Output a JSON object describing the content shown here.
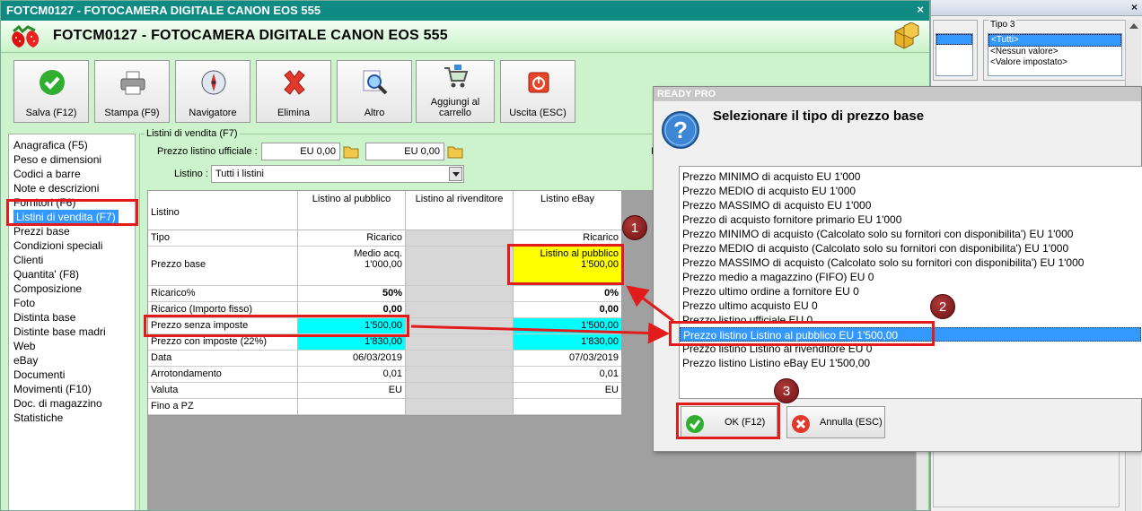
{
  "background_window": {
    "group_label": "Tipo 3",
    "options": [
      "<Tutti>",
      "<Nessun valore>",
      "<Valore impostato>"
    ]
  },
  "window": {
    "title": "FOTCM0127 - FOTOCAMERA DIGITALE CANON EOS 555",
    "close_glyph": "×",
    "header_title": "FOTCM0127 - FOTOCAMERA DIGITALE CANON EOS 555"
  },
  "toolbar": {
    "save": "Salva (F12)",
    "print": "Stampa (F9)",
    "navigator": "Navigatore",
    "delete": "Elimina",
    "other": "Altro",
    "cart_line1": "Aggiungi al",
    "cart_line2": "carrello",
    "exit": "Uscita (ESC)"
  },
  "nav": {
    "items": [
      "Anagrafica (F5)",
      "Peso e dimensioni",
      "Codici a barre",
      "Note e descrizioni",
      "Fornitori (F6)",
      "Listini di vendita (F7)",
      "Prezzi base",
      "Condizioni speciali",
      "Clienti",
      "Quantita' (F8)",
      "Composizione",
      "Foto",
      "Distinta base",
      "Distinte base madri",
      "Web",
      "eBay",
      "Documenti",
      "Movimenti (F10)",
      "Doc. di magazzino",
      "Statistiche"
    ],
    "selected_index": 5
  },
  "listini": {
    "group_title": "Listini di vendita (F7)",
    "prezzo_label": "Prezzo listino ufficiale :",
    "prezzo_value1": "EU 0,00",
    "prezzo_value2": "EU 0,00",
    "listino_label": "Listino :",
    "listino_value": "Tutti i listini",
    "truncated_label": "I"
  },
  "grid": {
    "corner": "Listino",
    "columns": [
      "Listino al pubblico",
      "Listino al rivenditore",
      "Listino eBay"
    ],
    "rows": [
      {
        "label": "Tipo",
        "v1": "Ricarico",
        "v3": "Ricarico"
      },
      {
        "label": "Prezzo base",
        "v1a": "Medio acq.",
        "v1b": "1'000,00",
        "v3a": "Listino al pubblico",
        "v3b": "1'500,00"
      },
      {
        "label": "Ricarico%",
        "v1": "50%",
        "v3": "0%"
      },
      {
        "label": "Ricarico (Importo fisso)",
        "v1": "0,00",
        "v3": "0,00"
      },
      {
        "label": "Prezzo senza imposte",
        "v1": "1'500,00",
        "v3": "1'500,00"
      },
      {
        "label": "Prezzo con imposte (22%)",
        "v1": "1'830,00",
        "v3": "1'830,00"
      },
      {
        "label": "Data",
        "v1": "06/03/2019",
        "v3": "07/03/2019"
      },
      {
        "label": "Arrotondamento",
        "v1": "0,01",
        "v3": "0,01"
      },
      {
        "label": "Valuta",
        "v1": "EU",
        "v3": "EU"
      },
      {
        "label": "Fino a PZ",
        "v1": "",
        "v3": ""
      }
    ]
  },
  "dialog": {
    "title": "READY PRO",
    "question": "Selezionare il tipo di prezzo base",
    "options": [
      "Prezzo MINIMO di acquisto EU 1'000",
      "Prezzo MEDIO di acquisto EU 1'000",
      "Prezzo MASSIMO di acquisto EU 1'000",
      "Prezzo di acquisto fornitore primario EU 1'000",
      "Prezzo MINIMO di acquisto (Calcolato solo su fornitori con disponibilita') EU 1'000",
      "Prezzo MEDIO di acquisto (Calcolato solo su fornitori con disponibilita') EU 1'000",
      "Prezzo MASSIMO di acquisto (Calcolato solo su fornitori con disponibilita') EU 1'000",
      "Prezzo medio a magazzino (FIFO) EU 0",
      "Prezzo ultimo ordine a fornitore EU 0",
      "Prezzo ultimo acquisto EU 0",
      "Prezzo listino ufficiale EU 0",
      "Prezzo listino Listino al pubblico EU 1'500,00",
      "Prezzo listino Listino al rivenditore EU 0",
      "Prezzo listino Listino eBay EU 1'500,00"
    ],
    "selected_index": 11,
    "ok": "OK (F12)",
    "cancel": "Annulla (ESC)"
  },
  "annotations": {
    "badge1": "1",
    "badge2": "2",
    "badge3": "3",
    "color": "#e21c1c"
  }
}
